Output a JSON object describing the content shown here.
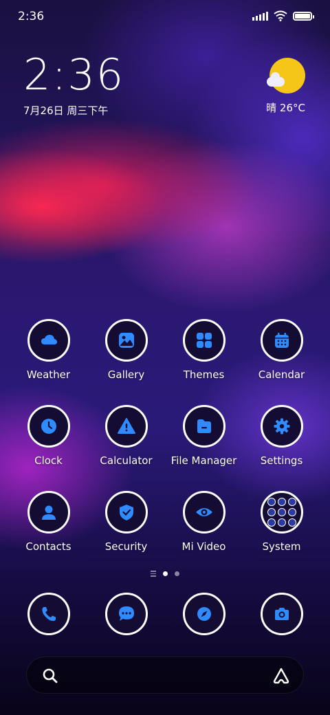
{
  "status_bar": {
    "time": "2:36"
  },
  "widget": {
    "clock": "2:36",
    "date": "7月26日 周三下午",
    "weather": "晴 26°C"
  },
  "apps": [
    {
      "label": "Weather",
      "icon": "weather-cloud-icon"
    },
    {
      "label": "Gallery",
      "icon": "gallery-icon"
    },
    {
      "label": "Themes",
      "icon": "themes-grid-icon"
    },
    {
      "label": "Calendar",
      "icon": "calendar-icon"
    },
    {
      "label": "Clock",
      "icon": "clock-icon"
    },
    {
      "label": "Calculator",
      "icon": "calculator-warning-icon"
    },
    {
      "label": "File Manager",
      "icon": "folder-icon"
    },
    {
      "label": "Settings",
      "icon": "gear-icon"
    },
    {
      "label": "Contacts",
      "icon": "person-icon"
    },
    {
      "label": "Security",
      "icon": "shield-check-icon"
    },
    {
      "label": "Mi Video",
      "icon": "eye-icon"
    },
    {
      "label": "System",
      "icon": "folder-grid-icon"
    }
  ],
  "dock": [
    {
      "name": "phone",
      "icon": "phone-icon"
    },
    {
      "name": "messages",
      "icon": "message-icon"
    },
    {
      "name": "browser",
      "icon": "compass-icon"
    },
    {
      "name": "camera",
      "icon": "camera-icon"
    }
  ],
  "colors": {
    "icon_accent": "#2f8bff",
    "icon_bg": "#140c32",
    "sun": "#f5c518"
  }
}
